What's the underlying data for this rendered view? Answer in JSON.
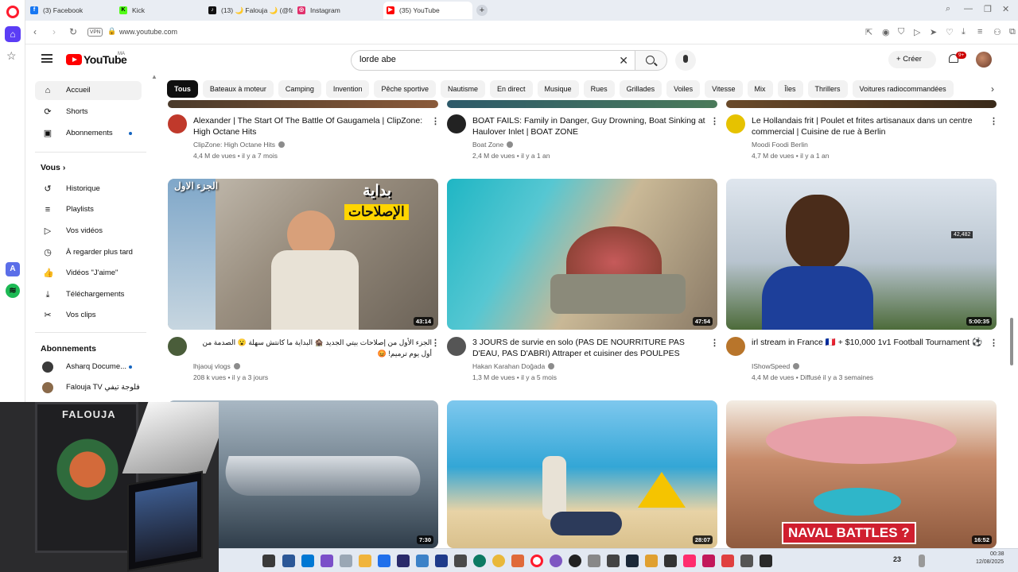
{
  "browser": {
    "tabs": [
      {
        "label": "(3) Facebook",
        "color": "#1877f2",
        "glyph": "f"
      },
      {
        "label": "Kick",
        "color": "#53fc18",
        "glyph": "K"
      },
      {
        "label": "(13) 🌙 Falouja 🌙 (@falo",
        "color": "#111111",
        "glyph": "♪"
      },
      {
        "label": "Instagram",
        "color": "#e1306c",
        "glyph": "◎"
      },
      {
        "label": "(35) YouTube",
        "color": "#ff0000",
        "glyph": "▶"
      }
    ],
    "new_tab_glyph": "+",
    "url": "www.youtube.com",
    "vpn_label": "VPN"
  },
  "youtube": {
    "logo_text": "YouTube",
    "region": "MA",
    "search_value": "lorde abe",
    "create_label": "Créer",
    "notif_count": "9+"
  },
  "sidebar": {
    "items": [
      {
        "label": "Accueil",
        "icon": "⌂"
      },
      {
        "label": "Shorts",
        "icon": "⟳"
      },
      {
        "label": "Abonnements",
        "icon": "▣"
      }
    ],
    "you_header": "Vous",
    "you_items": [
      {
        "label": "Historique",
        "icon": "↺"
      },
      {
        "label": "Playlists",
        "icon": "≡"
      },
      {
        "label": "Vos vidéos",
        "icon": "▷"
      },
      {
        "label": "À regarder plus tard",
        "icon": "◷"
      },
      {
        "label": "Vidéos \"J'aime\"",
        "icon": "👍"
      },
      {
        "label": "Téléchargements",
        "icon": "⤓"
      },
      {
        "label": "Vos clips",
        "icon": "✂"
      }
    ],
    "subs_header": "Abonnements",
    "subs": [
      {
        "label": "Asharq Docume...",
        "color": "#3a3a3a"
      },
      {
        "label": "Falouja TV فلوجة تيفي",
        "color": "#8a6a4a"
      }
    ]
  },
  "chips": [
    "Tous",
    "Bateaux à moteur",
    "Camping",
    "Invention",
    "Pêche sportive",
    "Nautisme",
    "En direct",
    "Musique",
    "Rues",
    "Grillades",
    "Voiles",
    "Vitesse",
    "Mix",
    "Îles",
    "Thrillers",
    "Voitures radiocommandées"
  ],
  "row1": [
    {
      "title": "Alexander | The Start Of The Battle Of Gaugamela | ClipZone: High Octane Hits",
      "channel": "ClipZone: High Octane Hits",
      "meta": "4,4 M de vues • il y a 7 mois",
      "avatar_color": "#c0392b"
    },
    {
      "title": "BOAT FAILS: Family in Danger, Guy Drowning, Boat Sinking at Haulover Inlet | BOAT ZONE",
      "channel": "Boat Zone",
      "meta": "2,4 M de vues • il y a 1 an",
      "avatar_color": "#222222"
    },
    {
      "title": "Le Hollandais frit | Poulet et frites artisanaux dans un centre commercial | Cuisine de rue à Berlin",
      "channel": "Moodi Foodi Berlin",
      "meta": "4,7 M de vues • il y a 1 an",
      "avatar_color": "#e6c200"
    }
  ],
  "row2": [
    {
      "title": "الجزء الأول من إصلاحات بيتي الجديد 🏚️ البداية ما كانتش سهلة 😮 الصدمة من أول يوم ترميم! 😡",
      "channel": "lhjaouj vlogs",
      "meta": "208 k vues • il y a 3 jours",
      "duration": "43:14",
      "avatar_color": "#4a5d3a",
      "overlay_top": "الجزء الاول",
      "overlay_banner1": "بداية",
      "overlay_banner2": "الإصلاحات"
    },
    {
      "title": "3 JOURS de survie en solo (PAS DE NOURRITURE PAS D'EAU, PAS D'ABRI) Attraper et cuisiner des POULPES",
      "channel": "Hakan Karahan Doğada",
      "meta": "1,3 M de vues • il y a 5 mois",
      "duration": "47:54",
      "avatar_color": "#555555"
    },
    {
      "title": "irl stream in France 🇫🇷 + $10,000 1v1 Football Tournament ⚽",
      "channel": "IShowSpeed",
      "meta": "4,4 M de vues • Diffusé il y a 3 semaines",
      "duration": "5:00:35",
      "avatar_color": "#b8752b",
      "overlay_count": "42,482"
    }
  ],
  "row3": [
    {
      "duration": "7:30"
    },
    {
      "duration": "28:07"
    },
    {
      "duration": "16:52",
      "overlay_text": "NAVAL BATTLES ?"
    }
  ],
  "webcam": {
    "poster_text": "FALOUJA"
  },
  "taskbar": {
    "time": "00:38",
    "date": "12/08/2025",
    "count_label": "23"
  }
}
